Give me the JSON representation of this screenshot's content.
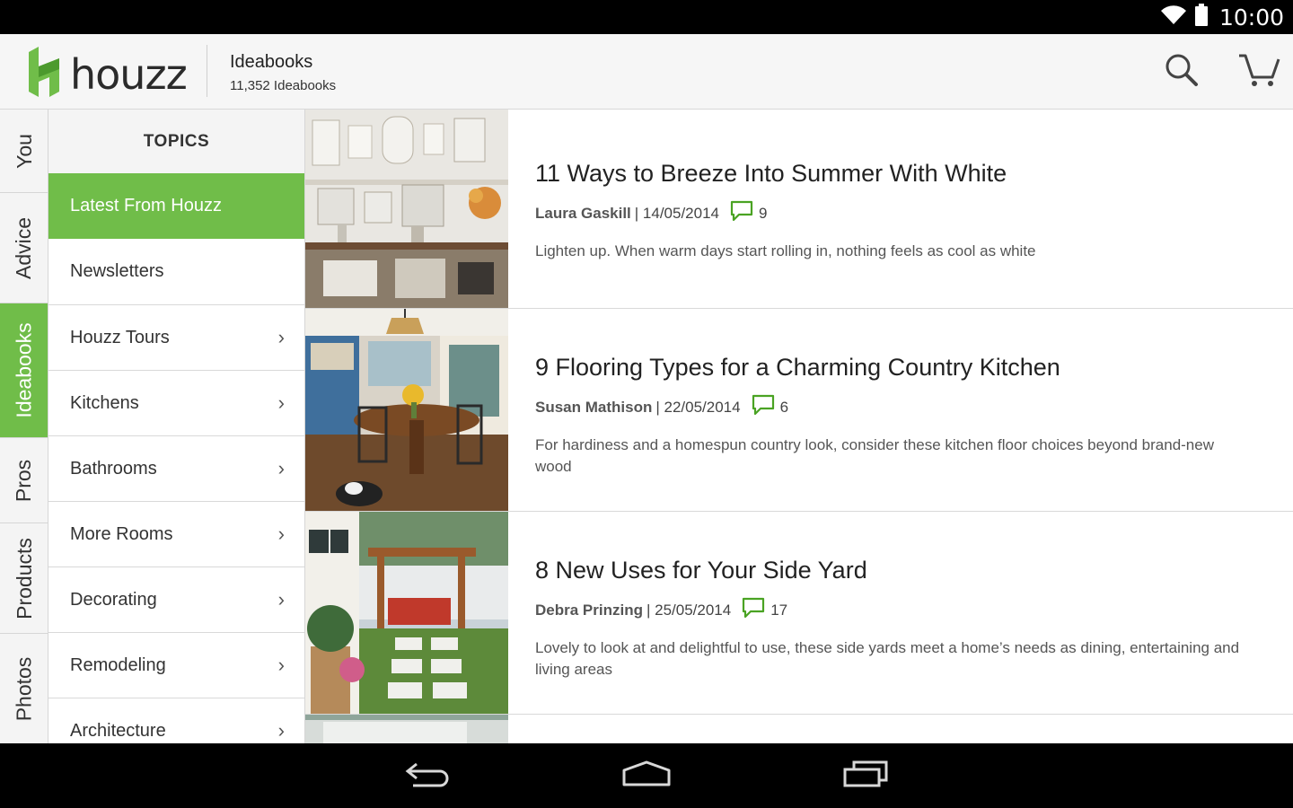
{
  "status_bar": {
    "time": "10:00",
    "icons": [
      "wifi-icon",
      "battery-icon"
    ]
  },
  "app_bar": {
    "logo_text": "houzz",
    "title": "Ideabooks",
    "subtitle": "11,352 Ideabooks",
    "icons": [
      "search-icon",
      "cart-icon"
    ]
  },
  "tabs": [
    "You",
    "Advice",
    "Ideabooks",
    "Pros",
    "Products",
    "Photos"
  ],
  "active_tab": "Ideabooks",
  "topics": {
    "header": "TOPICS",
    "items": [
      {
        "label": "Latest From Houzz",
        "active": true
      },
      {
        "label": "Newsletters"
      },
      {
        "label": "Houzz Tours",
        "has_chevron": true
      },
      {
        "label": "Kitchens",
        "has_chevron": true
      },
      {
        "label": "Bathrooms",
        "has_chevron": true
      },
      {
        "label": "More Rooms",
        "has_chevron": true
      },
      {
        "label": "Decorating",
        "has_chevron": true
      },
      {
        "label": "Remodeling",
        "has_chevron": true
      },
      {
        "label": "Architecture",
        "has_chevron": true
      }
    ]
  },
  "articles": [
    {
      "title": "11 Ways to Breeze Into Summer With White",
      "author": "Laura Gaskill",
      "date": "| 14/05/2014",
      "comments": "9",
      "description": "Lighten up. When warm days start rolling in, nothing feels as cool as white"
    },
    {
      "title": "9 Flooring Types for a Charming Country Kitchen",
      "author": "Susan Mathison",
      "date": "| 22/05/2014",
      "comments": "6",
      "description": "For hardiness and a homespun country look, consider these kitchen floor choices beyond brand-new wood"
    },
    {
      "title": "8 New Uses for Your Side Yard",
      "author": "Debra Prinzing",
      "date": "| 25/05/2014",
      "comments": "17",
      "description": "Lovely to look at and delightful to use, these side yards meet a home’s needs as dining, entertaining and living areas"
    }
  ],
  "nav_bar": {
    "icons": [
      "back-icon",
      "home-icon",
      "recent-apps-icon"
    ]
  },
  "colors": {
    "accent": "#70bd49",
    "status_bar": "#000000"
  }
}
